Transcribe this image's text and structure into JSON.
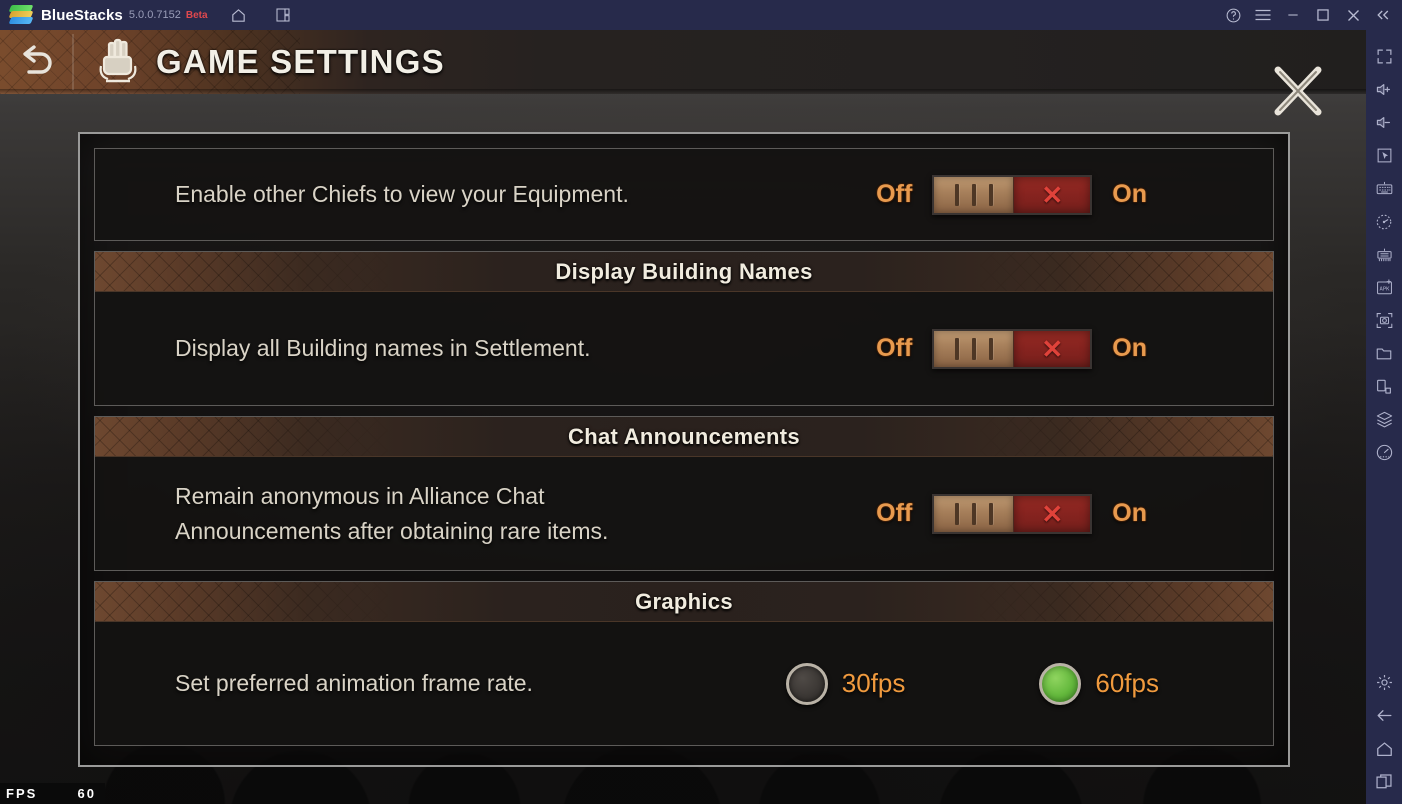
{
  "titlebar": {
    "app_name": "BlueStacks",
    "version": "5.0.0.7152",
    "beta_label": "Beta",
    "left_icons": [
      {
        "name": "home-icon",
        "label": "Home"
      },
      {
        "name": "multi-instance-icon",
        "label": "Multi-instance"
      }
    ],
    "right_icons": [
      {
        "name": "help-icon",
        "label": "Help"
      },
      {
        "name": "hamburger-menu-icon",
        "label": "Menu"
      },
      {
        "name": "minimize-icon",
        "label": "Minimize"
      },
      {
        "name": "maximize-icon",
        "label": "Maximize"
      },
      {
        "name": "close-icon",
        "label": "Close"
      },
      {
        "name": "collapse-sidebar-icon",
        "label": "Collapse"
      }
    ],
    "bg_color": "#272a4b",
    "icon_color": "#b9bcd2",
    "beta_color": "#e0484d"
  },
  "sidebar": {
    "bg_color": "#272a4b",
    "icon_color": "#aeb1cb",
    "top_items": [
      {
        "name": "fullscreen-icon",
        "label": "Fullscreen"
      },
      {
        "name": "volume-up-icon",
        "label": "Volume up"
      },
      {
        "name": "volume-down-icon",
        "label": "Volume down"
      },
      {
        "name": "cursor-pointer-icon",
        "label": "Pointer"
      },
      {
        "name": "keyboard-controls-icon",
        "label": "Game controls"
      },
      {
        "name": "eco-mode-icon",
        "label": "Eco mode"
      },
      {
        "name": "macro-recorder-icon",
        "label": "Macro recorder"
      },
      {
        "name": "install-apk-icon",
        "label": "Install APK"
      },
      {
        "name": "screenshot-icon",
        "label": "Screenshot"
      },
      {
        "name": "media-folder-icon",
        "label": "Media manager"
      },
      {
        "name": "rotate-screen-icon",
        "label": "Rotate"
      },
      {
        "name": "multi-instance-manager-icon",
        "label": "Instance manager"
      },
      {
        "name": "performance-meter-icon",
        "label": "Performance"
      }
    ],
    "bottom_items": [
      {
        "name": "settings-gear-icon",
        "label": "Settings"
      },
      {
        "name": "back-arrow-icon",
        "label": "Back"
      },
      {
        "name": "android-home-icon",
        "label": "Home"
      },
      {
        "name": "recent-apps-icon",
        "label": "Recent apps"
      }
    ]
  },
  "game_header": {
    "title": "GAME SETTINGS",
    "back_button_label": "Back",
    "close_button_label": "Close",
    "icon_name": "fist-emblem-icon"
  },
  "settings": {
    "groups": [
      {
        "id": "equipment",
        "has_title": false,
        "title": "",
        "rows": [
          {
            "type": "toggle",
            "label": "Enable other Chiefs to view your Equipment.",
            "off_label": "Off",
            "on_label": "On",
            "state": "Off",
            "mark": "✕"
          }
        ]
      },
      {
        "id": "display-building-names",
        "has_title": true,
        "title": "Display Building Names",
        "rows": [
          {
            "type": "toggle",
            "label": "Display all Building names in Settlement.",
            "off_label": "Off",
            "on_label": "On",
            "state": "Off",
            "mark": "✕"
          }
        ]
      },
      {
        "id": "chat-announcements",
        "has_title": true,
        "title": "Chat Announcements",
        "rows": [
          {
            "type": "toggle",
            "label": "Remain anonymous in Alliance Chat\nAnnouncements after obtaining rare items.",
            "off_label": "Off",
            "on_label": "On",
            "state": "Off",
            "mark": "✕"
          }
        ]
      },
      {
        "id": "graphics",
        "has_title": true,
        "title": "Graphics",
        "rows": [
          {
            "type": "radio",
            "label": "Set preferred animation frame rate.",
            "options": [
              {
                "label": "30fps",
                "selected": false
              },
              {
                "label": "60fps",
                "selected": true
              }
            ]
          }
        ]
      }
    ]
  },
  "fps_counter": {
    "label": "FPS",
    "value": "60"
  },
  "colors": {
    "accent_orange": "#e89a4e",
    "radio_orange": "#f09a3e",
    "toggle_red": "#86231f",
    "toggle_knob": "#a8815c",
    "selected_green": "#63b83c",
    "panel_border": "#9a9a99",
    "title_text": "#f1ecdf"
  }
}
